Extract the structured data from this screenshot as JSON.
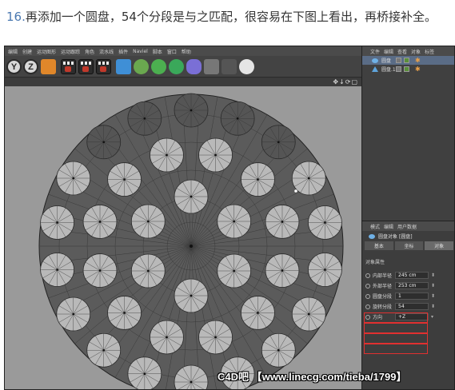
{
  "caption": {
    "number": "16.",
    "text": "再添加一个圆盘，54个分段是与之匹配，很容易在下图上看出，再桥接补全。"
  },
  "menu": [
    "编辑",
    "创建",
    "运动图形",
    "运动跟踪",
    "角色",
    "流水线",
    "插件",
    "Naviel",
    "脚本",
    "窗口",
    "帮助"
  ],
  "toolbar": {
    "y_label": "Y",
    "z_label": "Z"
  },
  "viewport": {
    "nav_icons": "✥↓⟳▢"
  },
  "object_panel": {
    "menu": [
      "文件",
      "编辑",
      "查看",
      "对象",
      "标签"
    ],
    "objects": [
      {
        "name": "圆盘",
        "selected": true
      },
      {
        "name": "圆盘.1",
        "selected": false
      }
    ]
  },
  "attr_panel": {
    "menu": [
      "模式",
      "编辑",
      "用户数据"
    ],
    "object_title": "圆盘对象 [圆盘]",
    "tabs": [
      "基本",
      "坐标",
      "对象"
    ],
    "section": "对象属性",
    "params": [
      {
        "label": "内部半径",
        "value": "245 cm"
      },
      {
        "label": "外部半径",
        "value": "253 cm"
      },
      {
        "label": "圆盘分段",
        "value": "1"
      },
      {
        "label": "旋转分段",
        "value": "54"
      },
      {
        "label": "方向",
        "value": "+Z"
      }
    ],
    "highlight_color": "#e03030"
  },
  "watermark": "C4D吧 【www.linecg.com/tieba/1799】"
}
